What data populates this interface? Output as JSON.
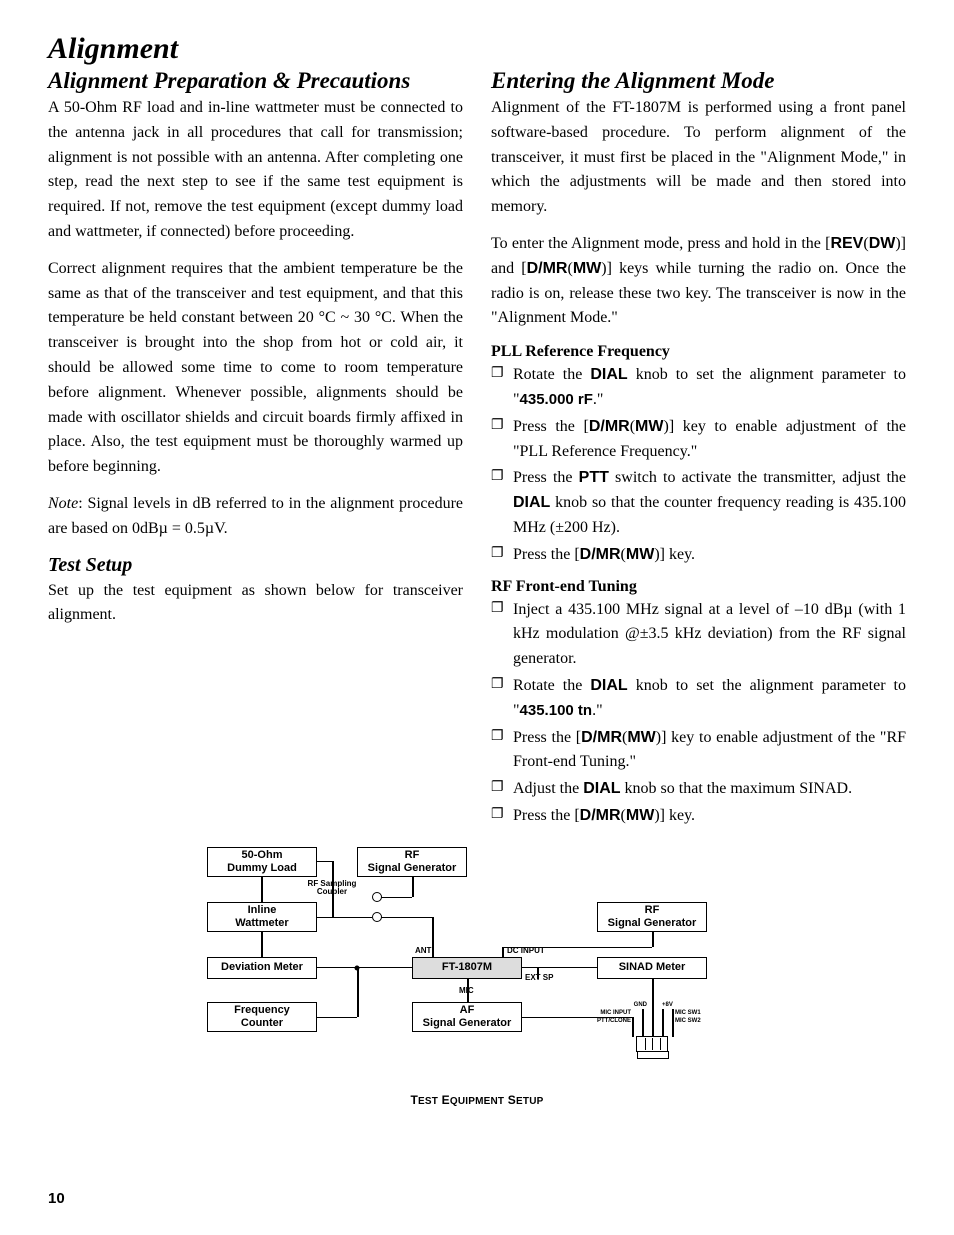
{
  "title": "Alignment",
  "left": {
    "h_prep": "Alignment Preparation & Precautions",
    "p1": "A 50-Ohm RF load and in-line wattmeter must be connected to the antenna jack in all procedures that call for transmission; alignment is not possible with an antenna. After completing one step, read the next step to see if the same test equipment is required. If not, remove the test equipment (except dummy load and wattmeter, if connected) before proceeding.",
    "p2": "Correct alignment requires that the ambient temperature be the same as that of the transceiver and test equipment, and that this temperature be held constant between 20 °C ~ 30 °C. When the transceiver is brought into the shop from hot or cold air, it should be allowed some time to come to room temperature before alignment. Whenever possible, alignments should be made with oscillator shields and circuit boards firmly affixed in place. Also, the test equipment must be thoroughly warmed up before beginning.",
    "note_label": "Note",
    "note_rest": ": Signal levels in dB referred to in the alignment procedure are based on 0dBµ = 0.5µV.",
    "h_test": "Test Setup",
    "p_test": "Set up the test equipment as shown below for transceiver alignment."
  },
  "right": {
    "h_enter": "Entering the Alignment Mode",
    "p1": "Alignment of the FT-1807M is performed using a front panel software-based procedure. To perform alignment of the transceiver, it must first be placed in the \"Alignment Mode,\" in which the adjustments will be made and then stored into memory.",
    "p2a": "To enter the Alignment mode, press and hold in the [",
    "rev": "REV",
    "p2b": "(",
    "dw": "DW",
    "p2c": ")] and [",
    "dmr": "D/MR",
    "p2d": "(",
    "mw": "MW",
    "p2e": ")] keys while turning the radio on. Once the radio is on, release these two key. The transceiver is now in the \"Alignment Mode.\"",
    "pll_head": "PLL Reference Frequency",
    "pll": {
      "i1a": "Rotate the ",
      "i1b": "DIAL",
      "i1c": " knob to set the alignment parameter to \"",
      "i1d": "435.000 rF",
      "i1e": ".\"",
      "i2a": "Press the [",
      "i2b": "D/MR",
      "i2c": "(",
      "i2d": "MW",
      "i2e": ")] key to enable adjustment of the \"PLL Reference Frequency.\"",
      "i3a": "Press the ",
      "i3b": "PTT",
      "i3c": " switch to activate the transmitter, adjust the ",
      "i3d": "DIAL",
      "i3e": " knob so that the counter frequency reading is 435.100 MHz (±200 Hz).",
      "i4a": "Press the [",
      "i4b": "D/MR",
      "i4c": "(",
      "i4d": "MW",
      "i4e": ")] key."
    },
    "rf_head": "RF Front-end Tuning",
    "rf": {
      "i1": "Inject a 435.100 MHz signal at a level of –10 dBµ (with 1 kHz modulation @±3.5 kHz deviation) from the RF signal generator.",
      "i2a": "Rotate the ",
      "i2b": "DIAL",
      "i2c": " knob to set the alignment parameter to \"",
      "i2d": "435.100 tn",
      "i2e": ".\"",
      "i3a": "Press the [",
      "i3b": "D/MR",
      "i3c": "(",
      "i3d": "MW",
      "i3e": ")] key to enable adjustment of the \"RF Front-end Tuning.\"",
      "i4a": "Adjust the ",
      "i4b": "DIAL",
      "i4c": " knob so that the maximum SINAD.",
      "i5a": "Press the [",
      "i5b": "D/MR",
      "i5c": "(",
      "i5d": "MW",
      "i5e": ")] key."
    }
  },
  "diagram": {
    "boxes": {
      "dummy": "50-Ohm\nDummy Load",
      "rfgen_top": "RF\nSignal Generator",
      "inline": "Inline\nWattmeter",
      "rfgen_right": "RF\nSignal Generator",
      "dev": "Deviation Meter",
      "center": "FT-1807M",
      "sinad": "SINAD Meter",
      "freq": "Frequency\nCounter",
      "afgen": "AF\nSignal Generator"
    },
    "labels": {
      "coupler": "RF Sampling\nCoupler",
      "ant": "ANT",
      "dcin": "DC INPUT",
      "extsp": "EXT SP",
      "mic": "MIC",
      "gnd": "GND",
      "8v": "+8V",
      "micin": "MIC INPUT",
      "micsw1": "MIC SW1",
      "pttclone": "PTT/CLONE",
      "micsw2": "MIC SW2"
    },
    "caption": "Test Equipment Setup"
  },
  "page_number": "10"
}
